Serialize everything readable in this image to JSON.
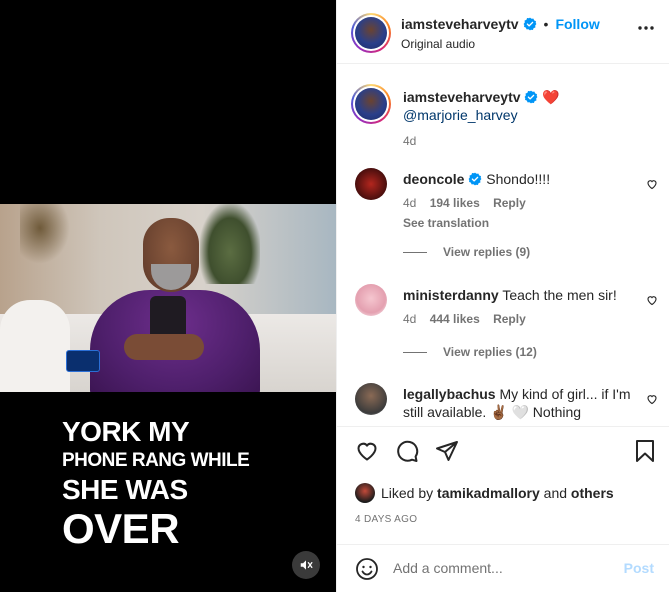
{
  "media": {
    "caption_lines": [
      "YORK MY",
      "PHONE RANG WHILE",
      "SHE WAS",
      "OVER"
    ],
    "mute_icon": "speaker-muted-icon"
  },
  "header": {
    "username": "iamsteveharveytv",
    "separator": "•",
    "follow_label": "Follow",
    "audio_label": "Original audio",
    "more_icon": "more-horizontal-icon"
  },
  "caption_post": {
    "username": "iamsteveharveytv",
    "emoji": "❤️",
    "mention": "@marjorie_harvey",
    "time": "4d"
  },
  "comments": [
    {
      "username": "deoncole",
      "verified": true,
      "text": "Shondo!!!!",
      "time": "4d",
      "likes": "194 likes",
      "reply_label": "Reply",
      "translate": "See translation",
      "view_replies": "View replies (9)"
    },
    {
      "username": "ministerdanny",
      "verified": false,
      "text": "Teach the men sir!",
      "time": "4d",
      "likes": "444 likes",
      "reply_label": "Reply",
      "view_replies": "View replies (12)"
    },
    {
      "username": "legallybachus",
      "verified": false,
      "text": "My kind of girl... if I'm still available. ✌🏾 🤍 Nothing"
    }
  ],
  "actions": {
    "like_icon": "heart-icon",
    "comment_icon": "comment-icon",
    "share_icon": "send-icon",
    "save_icon": "bookmark-icon"
  },
  "likes_summary": {
    "prefix": "Liked by",
    "user": "tamikadmallory",
    "and": "and",
    "others": "others"
  },
  "post_date": "4 DAYS AGO",
  "comment_box": {
    "placeholder": "Add a comment...",
    "post_label": "Post",
    "emoji_icon": "smiley-icon"
  },
  "colors": {
    "accent": "#0095f6",
    "verified": "#0095f6",
    "heart": "#ff3040",
    "post_disabled": "#b3dbff",
    "meta": "#737373"
  }
}
